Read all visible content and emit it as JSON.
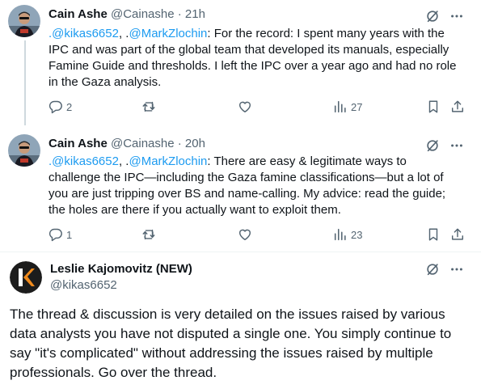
{
  "tweets": [
    {
      "name": "Cain Ashe",
      "handle": "@Cainashe",
      "separator": "·",
      "time": "21h",
      "mention_prefix_1": ".",
      "mention_1": "@kikas6652",
      "mention_sep": ", .",
      "mention_2": "@MarkZlochin",
      "text": ": For the record: I spent many years with the IPC and was part of the global team that developed its manuals, especially Famine Guide and thresholds. I left the IPC over a year ago and had no role in the Gaza analysis.",
      "replies": "2",
      "retweets": "",
      "likes": "",
      "views": "27"
    },
    {
      "name": "Cain Ashe",
      "handle": "@Cainashe",
      "separator": "·",
      "time": "20h",
      "mention_prefix_1": ".",
      "mention_1": "@kikas6652",
      "mention_sep": ", .",
      "mention_2": "@MarkZlochin",
      "text": ": There are easy & legitimate ways to challenge the IPC—including the Gaza famine classifications—but a lot of you are just tripping over BS and name-calling. My advice: read the guide; the holes are there if you actually want to exploit them.",
      "replies": "1",
      "retweets": "",
      "likes": "",
      "views": "23"
    }
  ],
  "main_tweet": {
    "name": "Leslie Kajomovitz (NEW)",
    "handle": "@kikas6652",
    "avatar_letter": "K",
    "text": "The thread & discussion is very detailed on the issues raised by various data analysts you have not disputed a single one. You simply continue to say \"it's complicated\" without addressing the issues raised by multiple professionals. Go over the thread."
  },
  "colors": {
    "accent": "#1d9bf0",
    "text": "#0f1419",
    "secondary": "#536471",
    "divider": "#eff3f4"
  },
  "icons": [
    "grok-icon",
    "more-icon",
    "reply-icon",
    "retweet-icon",
    "like-icon",
    "views-icon",
    "bookmark-icon",
    "share-icon"
  ]
}
